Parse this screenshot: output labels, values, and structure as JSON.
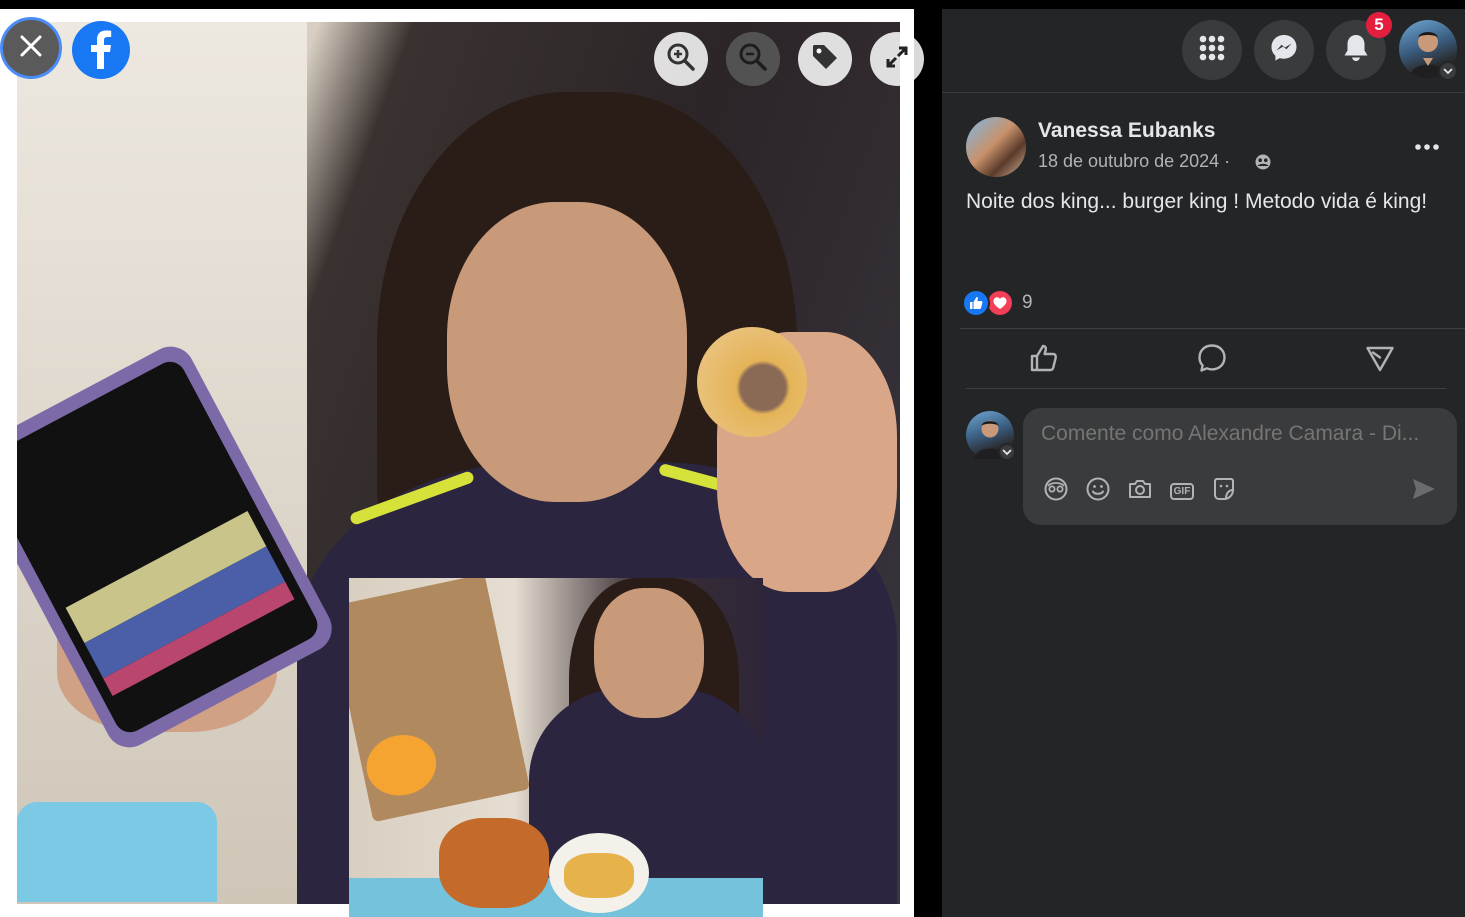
{
  "viewer": {
    "close_label": "Close",
    "zoom_in": "zoom-in-icon",
    "zoom_out": "zoom-out-icon",
    "tag": "tag-icon",
    "fullscreen": "fullscreen-icon"
  },
  "topbar": {
    "notifications_count": "5"
  },
  "post": {
    "author": "Vanessa Eubanks",
    "date": "18 de outubro de 2024 ·",
    "text": "Noite dos king... burger king ! Metodo vida é king!",
    "reaction_count": "9"
  },
  "comment": {
    "placeholder": "Comente como Alexandre Camara - Di..."
  },
  "colors": {
    "panel_bg": "#242526",
    "input_bg": "#3a3b3c",
    "accent_blue": "#1877f2",
    "badge_red": "#e41e3f",
    "love_red": "#f33e58"
  }
}
